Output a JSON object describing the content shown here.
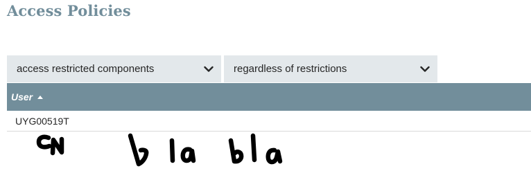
{
  "page": {
    "title": "Access Policies"
  },
  "filters": {
    "action_select": "access restricted components",
    "resource_select": "regardless of restrictions"
  },
  "table": {
    "columns": [
      {
        "label": "User",
        "sort": "ascending"
      }
    ],
    "rows": [
      {
        "user": "UYG00519T"
      }
    ]
  },
  "annotation": {
    "handwriting": "CN bla bla"
  },
  "colors": {
    "accent": "#728e9b",
    "select_bg": "#e3e8eb",
    "text": "#262626"
  }
}
